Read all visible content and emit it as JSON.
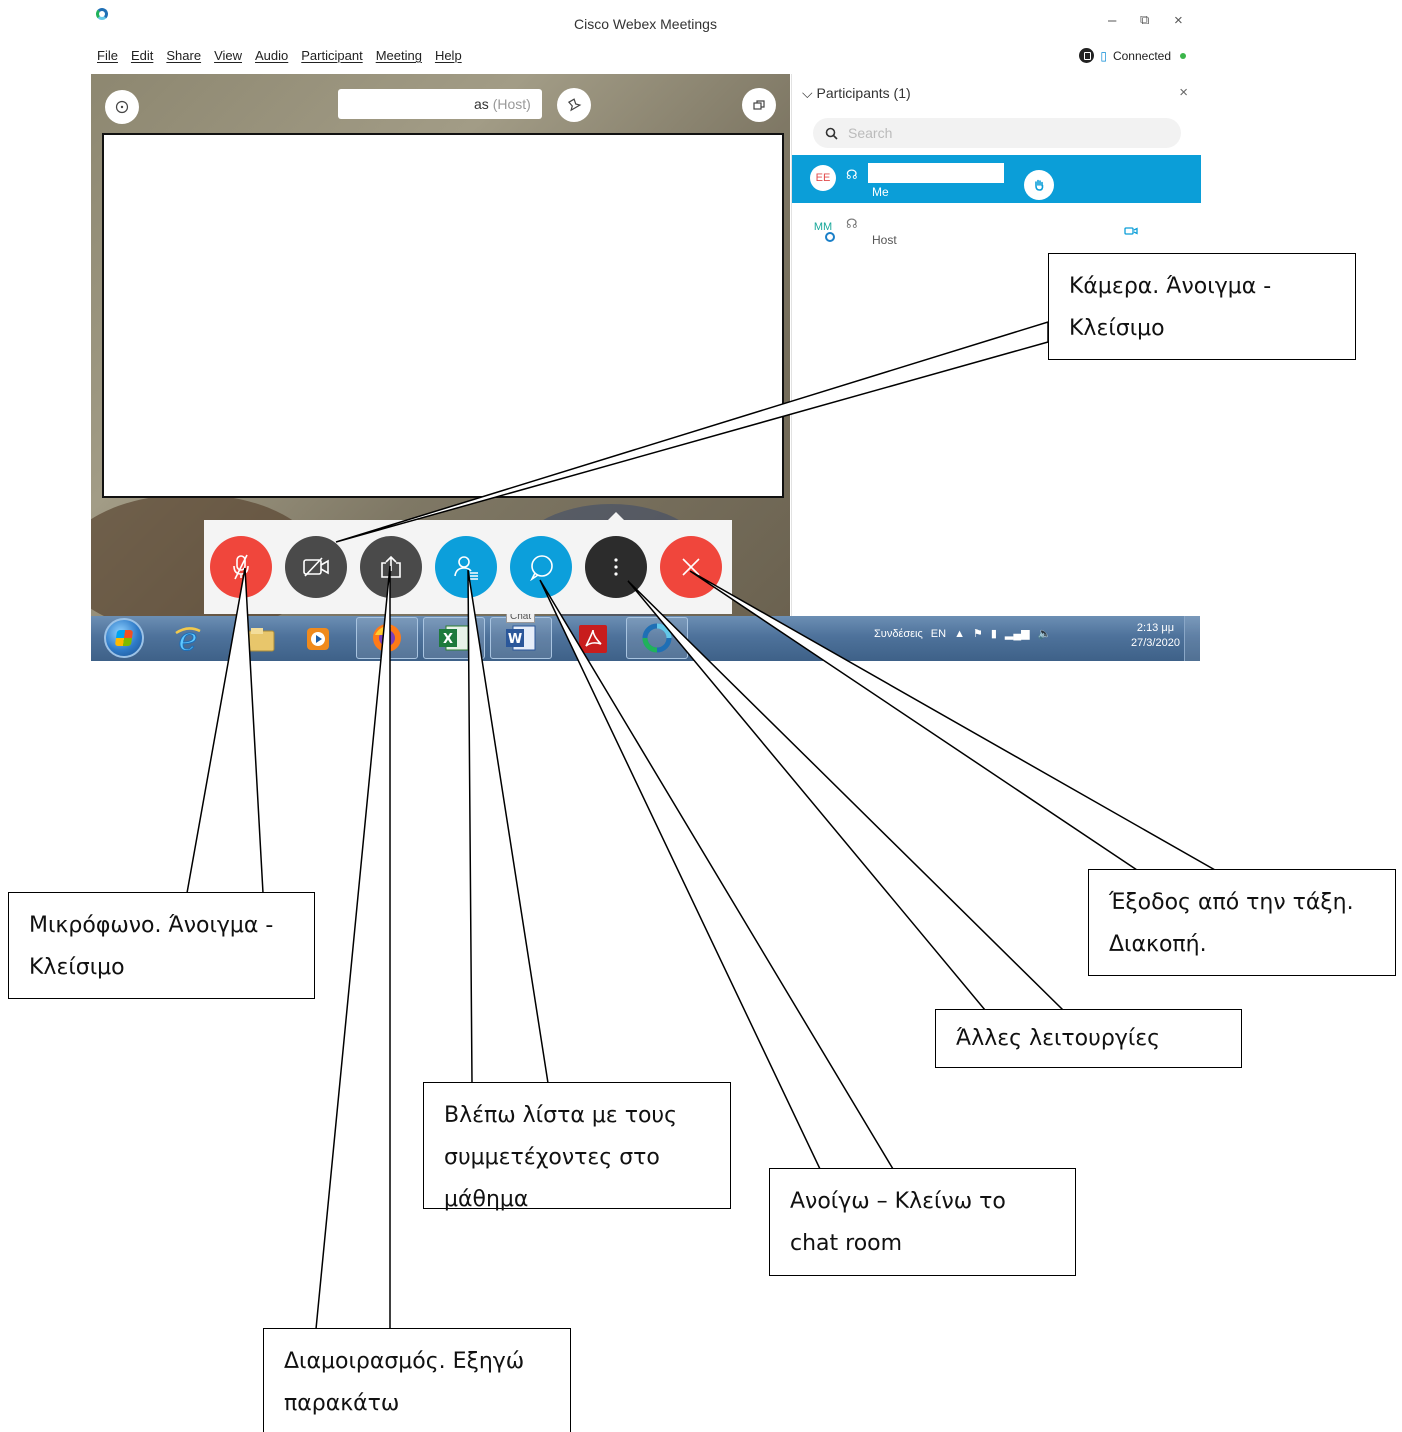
{
  "window": {
    "title": "Cisco Webex Meetings",
    "controls": {
      "minimize": "–",
      "maximize": "⧉",
      "close": "×"
    }
  },
  "menu": [
    "File",
    "Edit",
    "Share",
    "View",
    "Audio",
    "Participant",
    "Meeting",
    "Help"
  ],
  "status": {
    "connection": "Connected"
  },
  "stage": {
    "host_suffix_visible": "as",
    "host_tag": "(Host)"
  },
  "participants_panel": {
    "title": "Participants (1)",
    "search_placeholder": "Search",
    "items": [
      {
        "initials": "EE",
        "role": "Me",
        "highlighted": true
      },
      {
        "initials": "MM",
        "role": "Host",
        "highlighted": false
      }
    ]
  },
  "controls_bar": [
    {
      "name": "mute-button",
      "icon": "mic-off-icon",
      "color": "#f0463c"
    },
    {
      "name": "video-button",
      "icon": "camera-off-icon",
      "color": "#4a4a4a"
    },
    {
      "name": "share-button",
      "icon": "share-icon",
      "color": "#4a4a4a"
    },
    {
      "name": "participants-button",
      "icon": "participants-icon",
      "color": "#0c9fdb"
    },
    {
      "name": "chat-button",
      "icon": "chat-icon",
      "color": "#0c9fdb"
    },
    {
      "name": "more-button",
      "icon": "more-icon",
      "color": "#2c2c2c"
    },
    {
      "name": "leave-button",
      "icon": "close-icon",
      "color": "#f0463c"
    }
  ],
  "taskbar": {
    "tooltip": "Chat",
    "tray_label": "Συνδέσεις",
    "language": "EN",
    "time": "2:13 μμ",
    "date": "27/3/2020"
  },
  "annotations": {
    "camera": "Κάμερα. Άνοιγμα - Κλείσιμο",
    "microphone": "Μικρόφωνο. Άνοιγμα - Κλείσιμο",
    "exit": "Έξοδος από την τάξη. Διακοπή.",
    "more": "Άλλες λειτουργίες",
    "participants": "Βλέπω λίστα με τους συμμετέχοντες στο μάθημα",
    "chat": "Ανοίγω – Κλείνω το chat room",
    "share": "Διαμοιρασμός. Εξηγώ παρακάτω"
  },
  "colors": {
    "accent_blue": "#0c9fdb",
    "danger_red": "#f0463c",
    "connected_green": "#3bb54a"
  }
}
